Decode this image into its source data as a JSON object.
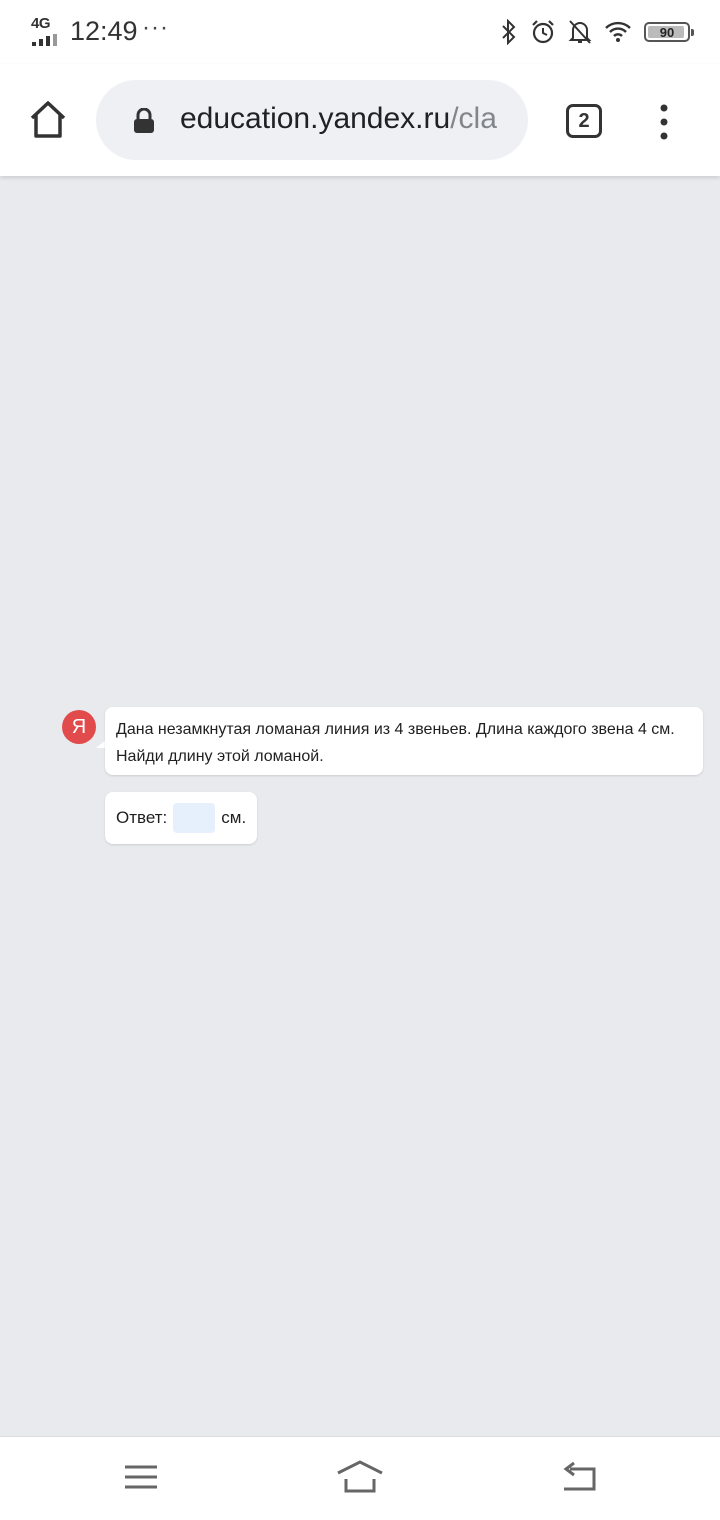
{
  "status_bar": {
    "network": "4G",
    "time": "12:49",
    "more": "···",
    "battery": "90",
    "icons": [
      "bluetooth-icon",
      "alarm-icon",
      "silent-bell-icon",
      "wifi-icon",
      "battery-icon"
    ]
  },
  "browser": {
    "url_domain": "education.yandex.ru",
    "url_path": "/cla",
    "tab_count": "2"
  },
  "task": {
    "avatar_letter": "Я",
    "text": "Дана незамкнутая ломаная линия из 4 звеньев. Длина каждого звена 4 см. Найди длину этой ломаной.",
    "answer_label": "Ответ:",
    "answer_value": "",
    "answer_unit": "см."
  },
  "colors": {
    "accent": "#e14b4b",
    "background": "#e9eaee",
    "input_bg": "#e6f0fd"
  }
}
